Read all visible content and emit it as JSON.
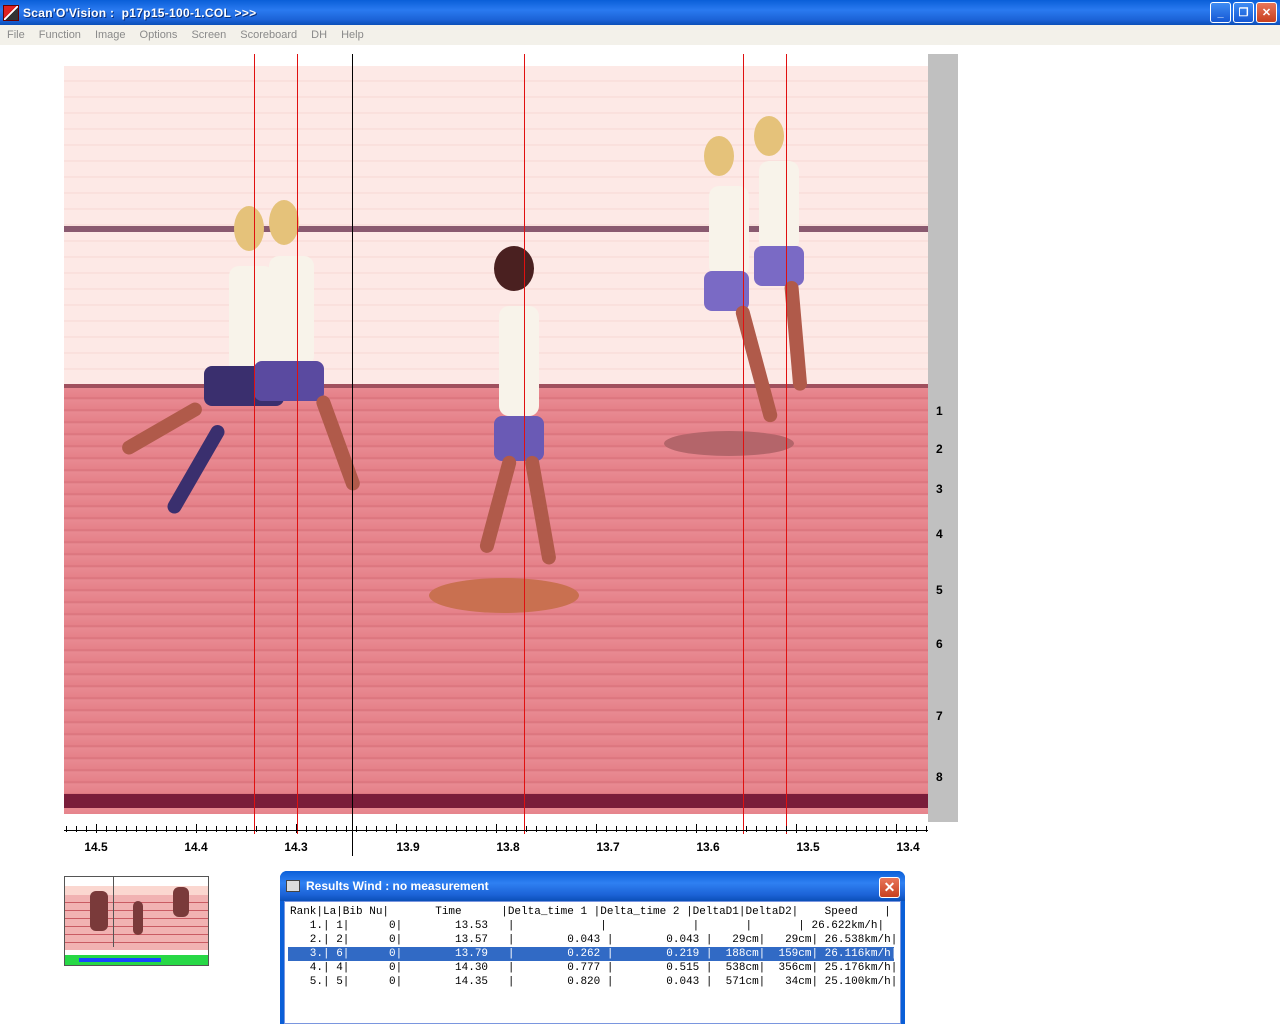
{
  "window": {
    "title": "Scan'O'Vision :  p17p15-100-1.COL >>>",
    "buttons": {
      "minimize": "_",
      "restore": "❐",
      "close": "✕"
    }
  },
  "menu": [
    "File",
    "Function",
    "Image",
    "Options",
    "Screen",
    "Scoreboard",
    "DH",
    "Help"
  ],
  "lanes": [
    "1",
    "2",
    "3",
    "4",
    "5",
    "6",
    "7",
    "8"
  ],
  "axis": {
    "labels": [
      "14.5",
      "14.4",
      "14.3",
      "13.9",
      "13.8",
      "13.7",
      "13.6",
      "13.5",
      "13.4"
    ]
  },
  "results": {
    "title": "Results   Wind : no measurement",
    "close": "✕",
    "header": "Rank|La|Bib Nu|       Time      |Delta_time 1 |Delta_time 2 |DeltaD1|DeltaD2|    Speed    |",
    "rows": [
      "   1.| 1|      0|        13.53   |             |             |       |       | 26.622km/h|",
      "   2.| 2|      0|        13.57   |        0.043 |        0.043 |   29cm|   29cm| 26.538km/h|",
      "   3.| 6|      0|        13.79   |        0.262 |        0.219 |  188cm|  159cm| 26.116km/h|",
      "   4.| 4|      0|        14.30   |        0.777 |        0.515 |  538cm|  356cm| 25.176km/h|",
      "   5.| 5|      0|        14.35   |        0.820 |        0.043 |  571cm|   34cm| 25.100km/h|"
    ],
    "selected_row": 2
  },
  "colors": {
    "accent": "#0a5fd8",
    "line": "#e01010",
    "selection": "#316ac5"
  },
  "icons": {
    "app": "scanovision-app-icon",
    "results": "printer-icon"
  }
}
